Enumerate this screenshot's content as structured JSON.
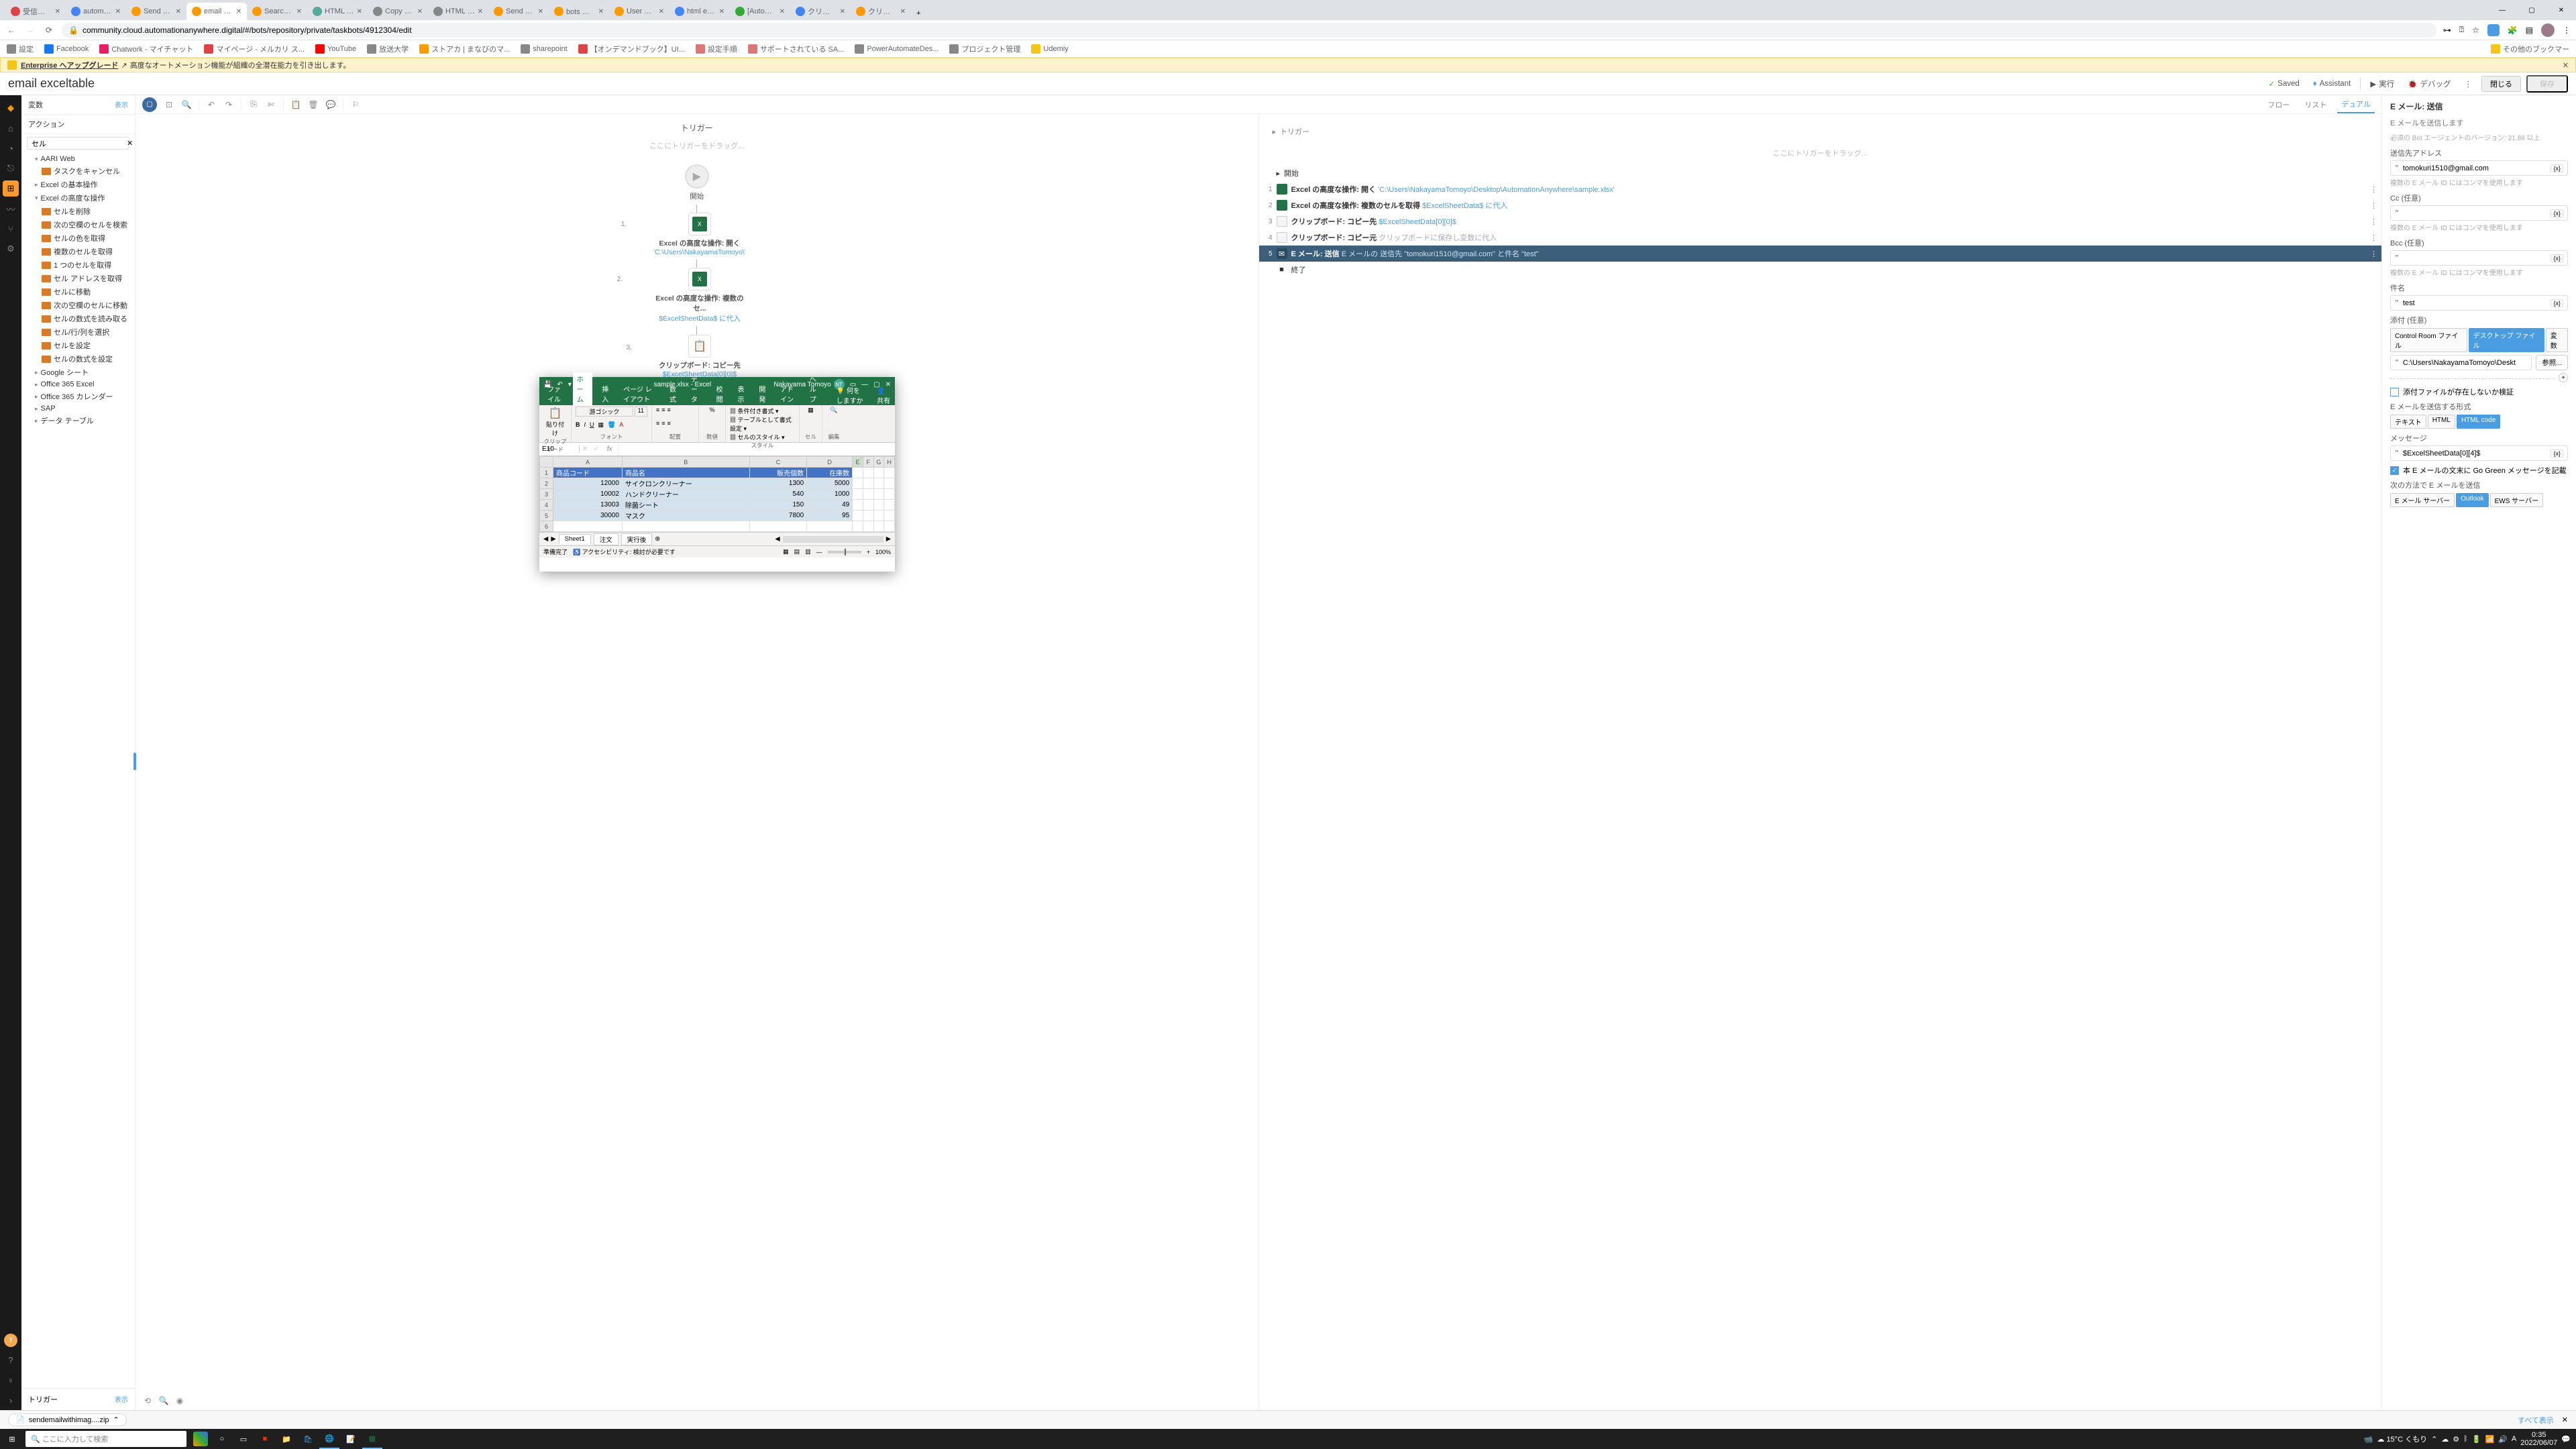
{
  "browser": {
    "tabs": [
      {
        "title": "受信トレイ"
      },
      {
        "title": "automation"
      },
      {
        "title": "Send Email"
      },
      {
        "title": "email excel",
        "active": true
      },
      {
        "title": "Search Res"
      },
      {
        "title": "HTML Table"
      },
      {
        "title": "Copy HTM"
      },
      {
        "title": "HTML email"
      },
      {
        "title": "Send Email"
      },
      {
        "title": "bots の作成"
      },
      {
        "title": "User workf"
      },
      {
        "title": "html email"
      },
      {
        "title": "[Automatic"
      },
      {
        "title": "クリップボー"
      },
      {
        "title": "クリップボー"
      }
    ],
    "url": "community.cloud.automationanywhere.digital/#/bots/repository/private/taskbots/4912304/edit",
    "bookmarks": [
      "設定",
      "Facebook",
      "Chatwork - マイチャット",
      "マイページ - メルカリ ス...",
      "YouTube",
      "放送大学",
      "ストアカ | まなびのマ...",
      "sharepoint",
      "【オンデマンドブック】UI...",
      "設定手順",
      "サポートされている SA...",
      "PowerAutomateDes...",
      "プロジェクト管理",
      "Udemiy"
    ],
    "bookmarks_other": "その他のブックマー"
  },
  "yellow_bar": {
    "link": "Enterprise へアップグレード",
    "text": "高度なオートメーション機能が組織の全潜在能力を引き出します。"
  },
  "header": {
    "bot_name": "email exceltable",
    "saved": "Saved",
    "assistant": "Assistant",
    "run": "実行",
    "debug": "デバッグ",
    "close": "閉じる",
    "save": "保存"
  },
  "views": {
    "flow": "フロー",
    "list": "リスト",
    "dual": "デュアル"
  },
  "left": {
    "vars_title": "変数",
    "vars_link": "表示",
    "actions_title": "アクション",
    "search_value": "セル",
    "tree": {
      "aari": "AARI Web",
      "aari_child": "タスクをキャンセル",
      "excel_basic": "Excel の基本操作",
      "excel_adv": "Excel の高度な操作",
      "adv_children": [
        "セルを削除",
        "次の空欄のセルを検索",
        "セルの色を取得",
        "複数のセルを取得",
        "1 つのセルを取得",
        "セル アドレスを取得",
        "セルに移動",
        "次の空欄のセルに移動",
        "セルの数式を読み取る",
        "セル/行/列を選択",
        "セルを設定",
        "セルの数式を設定"
      ],
      "google": "Google シート",
      "o365excel": "Office 365 Excel",
      "o365cal": "Office 365 カレンダー",
      "sap": "SAP",
      "datatable": "データ テーブル"
    },
    "trigger": "トリガー",
    "trigger_link": "表示"
  },
  "flow": {
    "trigger_title": "トリガー",
    "drop_hint": "ここにトリガーをドラッグ...",
    "start": "開始",
    "steps": [
      {
        "n": "1.",
        "title": "Excel の高度な操作: 開く",
        "sub": "'C:\\Users\\NakayamaTomoyo\\'"
      },
      {
        "n": "2.",
        "title": "Excel の高度な操作: 複数のセ...",
        "sub": "$ExcelSheetData$ に代入"
      },
      {
        "n": "3.",
        "title": "クリップボード: コピー先",
        "sub": "$ExcelSheetData[0][0]$"
      },
      {
        "n": "4.",
        "title": "クリップボード: コピー元",
        "sub": "クリップボードに保存し変数に"
      },
      {
        "n": "5.",
        "title": "E メール: 送信",
        "sub": "E メールの 送信先  'tomokuri1"
      }
    ]
  },
  "list": {
    "trigger": "トリガー",
    "drop": "ここにトリガーをドラッグ...",
    "start": "開始",
    "rows": [
      {
        "n": "1",
        "text": "Excel の高度な操作: 開く",
        "path": "'C:\\Users\\NakayamaTomoyo\\Desktop\\AutomationAnywhere\\sample.xlsx'"
      },
      {
        "n": "2",
        "text": "Excel の高度な操作: 複数のセルを取得",
        "path": "$ExcelSheetData$ に代入"
      },
      {
        "n": "3",
        "text": "クリップボード: コピー先",
        "path": "$ExcelSheetData[0][0]$"
      },
      {
        "n": "4",
        "text": "クリップボード: コピー元",
        "path": "クリップボードに保存し変数に代入"
      },
      {
        "n": "5",
        "text": "E メール: 送信",
        "path": "E メールの 送信先  \"tomokuri1510@gmail.com\" と件名  \"test\"",
        "selected": true
      }
    ],
    "end": "終了"
  },
  "right": {
    "title": "E メール: 送信",
    "desc": "E メールを送信します",
    "bot_version": "必須の Bot エージェントのバージョン: 21.88 以上",
    "to_label": "送信先アドレス",
    "to_value": "tomokuri1510@gmail.com",
    "to_hint": "複数の E メール ID にはコンマを使用します",
    "cc_label": "Cc (任意)",
    "cc_hint": "複数の E メール ID にはコンマを使用します",
    "bcc_label": "Bcc (任意)",
    "bcc_hint": "複数の E メール ID にはコンマを使用します",
    "subject_label": "件名",
    "subject_value": "test",
    "attach_label": "添付 (任意)",
    "attach_tabs": [
      "Control Room ファイル",
      "デスクトップ ファイル",
      "変数"
    ],
    "attach_path": "C:\\Users\\NakayamaTomoyo\\Deskt",
    "browse": "参照...",
    "attach_check": "添付ファイルが存在しないか検証",
    "format_label": "E メールを送信する形式",
    "format_tabs": [
      "テキスト",
      "HTML",
      "HTML code"
    ],
    "msg_label": "メッセージ",
    "msg_value": "$ExcelSheetData[0][4]$",
    "gogreen": "本 E メールの文末に Go Green メッセージを記載",
    "send_label": "次の方法で E メールを送信",
    "send_tabs": [
      "E メール サーバー",
      "Outlook",
      "EWS サーバー"
    ]
  },
  "excel": {
    "filename": "sample.xlsx - Excel",
    "user": "Nakayama Tomoyo",
    "user_initials": "NT",
    "tabs": [
      "ファイル",
      "ホーム",
      "挿入",
      "ページ レイアウト",
      "数式",
      "データ",
      "校閲",
      "表示",
      "開発",
      "アドイン",
      "ヘルプ"
    ],
    "tell_me": "何をしますか",
    "share": "共有",
    "groups": {
      "clipboard": "クリップボード",
      "font": "フォント",
      "align": "配置",
      "number": "数値",
      "styles": "スタイル",
      "cells": "セル",
      "edit": "編集"
    },
    "font_name": "游ゴシック",
    "font_size": "11",
    "cond_fmt": "条件付き書式",
    "table_fmt": "テーブルとして書式設定",
    "cell_style": "セルのスタイル",
    "paste": "貼り付け",
    "namebox": "E10",
    "cols": [
      "A",
      "B",
      "C",
      "D",
      "E",
      "F",
      "G",
      "H"
    ],
    "header_row": [
      "商品コード",
      "商品名",
      "販売個数",
      "在庫数"
    ],
    "data": [
      [
        "12000",
        "サイクロンクリーナー",
        "1300",
        "5000"
      ],
      [
        "10002",
        "ハンドクリーナー",
        "540",
        "1000"
      ],
      [
        "13003",
        "除菌シート",
        "150",
        "49"
      ],
      [
        "30000",
        "マスク",
        "7800",
        "95"
      ]
    ],
    "sheets": [
      "Sheet1",
      "注文",
      "実行後"
    ],
    "status": "準備完了",
    "accessibility": "アクセシビリティ: 検討が必要です",
    "zoom": "100%"
  },
  "download": {
    "file": "sendemailwithimag....zip",
    "show_all": "すべて表示"
  },
  "taskbar": {
    "search": "ここに入力して検索",
    "weather": "15°C くもり",
    "time": "0:35",
    "date": "2022/06/07"
  }
}
